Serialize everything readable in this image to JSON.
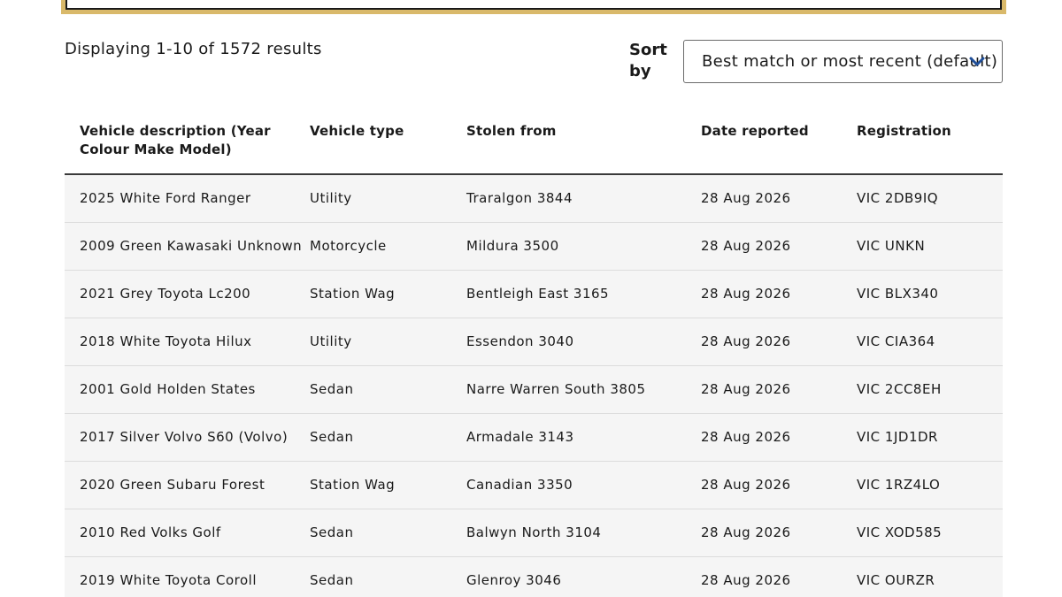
{
  "results": {
    "summary": "Displaying 1-10 of 1572 results"
  },
  "sort": {
    "label": "Sort by",
    "selected": "Best match or most recent (default)",
    "chevron_icon": "chevron-down-icon"
  },
  "table": {
    "columns": [
      "Vehicle description (Year Colour Make Model)",
      "Vehicle type",
      "Stolen from",
      "Date reported",
      "Registration"
    ],
    "rows": [
      [
        "2025 White Ford Ranger",
        "Utility",
        "Traralgon 3844",
        "28 Aug 2026",
        "VIC 2DB9IQ"
      ],
      [
        "2009 Green Kawasaki Unknown",
        "Motorcycle",
        "Mildura 3500",
        "28 Aug 2026",
        "VIC UNKN"
      ],
      [
        "2021 Grey Toyota Lc200",
        "Station Wag",
        "Bentleigh East 3165",
        "28 Aug 2026",
        "VIC BLX340"
      ],
      [
        "2018 White Toyota Hilux",
        "Utility",
        "Essendon 3040",
        "28 Aug 2026",
        "VIC CIA364"
      ],
      [
        "2001 Gold Holden States",
        "Sedan",
        "Narre Warren South 3805",
        "28 Aug 2026",
        "VIC 2CC8EH"
      ],
      [
        "2017 Silver Volvo S60 (Volvo)",
        "Sedan",
        "Armadale 3143",
        "28 Aug 2026",
        "VIC 1JD1DR"
      ],
      [
        "2020 Green Subaru Forest",
        "Station Wag",
        "Canadian 3350",
        "28 Aug 2026",
        "VIC 1RZ4LO"
      ],
      [
        "2010 Red Volks Golf",
        "Sedan",
        "Balwyn North 3104",
        "28 Aug 2026",
        "VIC XOD585"
      ],
      [
        "2019 White Toyota Coroll",
        "Sedan",
        "Glenroy 3046",
        "28 Aug 2026",
        "VIC OURZR"
      ]
    ]
  },
  "colors": {
    "accent_gold": "#d9b96a",
    "row_background": "#f5f5f5",
    "text": "#1a1a1a"
  }
}
